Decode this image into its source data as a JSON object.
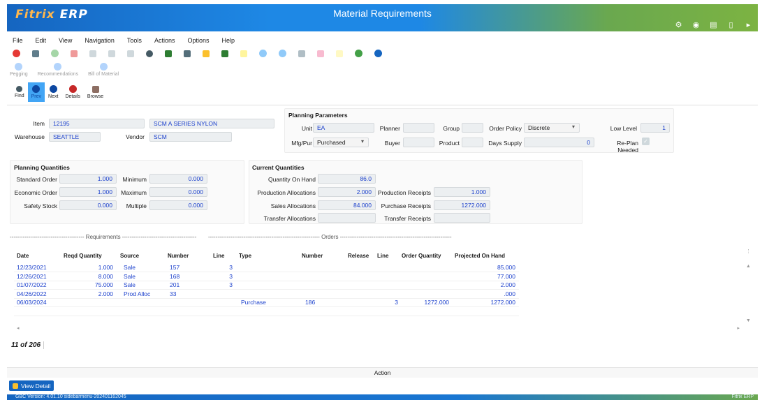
{
  "app": {
    "logo_main": "Fitrix",
    "logo_sub": "ERP",
    "title": "Material Requirements"
  },
  "menu": [
    "File",
    "Edit",
    "View",
    "Navigation",
    "Tools",
    "Actions",
    "Options",
    "Help"
  ],
  "toolbar2": {
    "pegging": "Pegging",
    "recommendations": "Recommendations",
    "bom": "Bill of Material"
  },
  "toolbar3": {
    "find": "Find",
    "prev": "Prev",
    "next": "Next",
    "details": "Details",
    "browse": "Browse"
  },
  "header": {
    "item_label": "Item",
    "item": "12195",
    "item_desc": "SCM A SERIES NYLON",
    "warehouse_label": "Warehouse",
    "warehouse": "SEATTLE",
    "vendor_label": "Vendor",
    "vendor": "SCM"
  },
  "planning_params": {
    "title": "Planning Parameters",
    "unit_label": "Unit",
    "unit": "EA",
    "planner_label": "Planner",
    "planner": "",
    "group_label": "Group",
    "group": "",
    "order_policy_label": "Order Policy",
    "order_policy": "Discrete",
    "low_level_label": "Low Level",
    "low_level": "1",
    "mfgpur_label": "Mfg/Pur",
    "mfgpur": "Purchased",
    "buyer_label": "Buyer",
    "buyer": "",
    "product_label": "Product",
    "product": "",
    "days_supply_label": "Days Supply",
    "days_supply": "0",
    "replan_label": "Re-Plan Needed"
  },
  "planning_qty": {
    "title": "Planning Quantities",
    "std_order_label": "Standard Order",
    "std_order": "1.000",
    "minimum_label": "Minimum",
    "minimum": "0.000",
    "econ_order_label": "Economic Order",
    "econ_order": "1.000",
    "maximum_label": "Maximum",
    "maximum": "0.000",
    "safety_label": "Safety Stock",
    "safety": "0.000",
    "multiple_label": "Multiple",
    "multiple": "0.000"
  },
  "current_qty": {
    "title": "Current Quantities",
    "on_hand_label": "Quantity On Hand",
    "on_hand": "86.0",
    "prod_alloc_label": "Production Allocations",
    "prod_alloc": "2.000",
    "prod_rcpt_label": "Production Receipts",
    "prod_rcpt": "1.000",
    "sales_alloc_label": "Sales Allocations",
    "sales_alloc": "84.000",
    "purch_rcpt_label": "Purchase Receipts",
    "purch_rcpt": "1272.000",
    "transfer_alloc_label": "Transfer Allocations",
    "transfer_alloc": "",
    "transfer_rcpt_label": "Transfer Receipts",
    "transfer_rcpt": ""
  },
  "separators": {
    "requirements": "---------------------------------------- Requirements ----------------------------------------",
    "orders": "------------------------------------------------------------ Orders ------------------------------------------------------------"
  },
  "table": {
    "headers": [
      "Date",
      "Reqd Quantity",
      "Source",
      "Number",
      "Line",
      "Type",
      "Number",
      "Release",
      "Line",
      "Order Quantity",
      "Projected On Hand"
    ],
    "rows": [
      [
        "12/23/2021",
        "1.000",
        "Sale",
        "157",
        "3",
        "",
        "",
        "",
        "",
        "",
        "85.000"
      ],
      [
        "12/26/2021",
        "8.000",
        "Sale",
        "168",
        "3",
        "",
        "",
        "",
        "",
        "",
        "77.000"
      ],
      [
        "01/07/2022",
        "75.000",
        "Sale",
        "201",
        "3",
        "",
        "",
        "",
        "",
        "",
        "2.000"
      ],
      [
        "04/26/2022",
        "2.000",
        "Prod Alloc",
        "33",
        "",
        "",
        "",
        "",
        "",
        "",
        ".000"
      ],
      [
        "06/03/2024",
        "",
        "",
        "",
        "",
        "Purchase",
        "186",
        "",
        "3",
        "1272.000",
        "1272.000"
      ]
    ]
  },
  "counter": "11 of 206",
  "action_label": "Action",
  "view_detail": "View Detail",
  "footer": {
    "version": "GBC Version: 4.01.10 sidebarmenu-202401162045",
    "brand": "Fitrix ERP"
  }
}
